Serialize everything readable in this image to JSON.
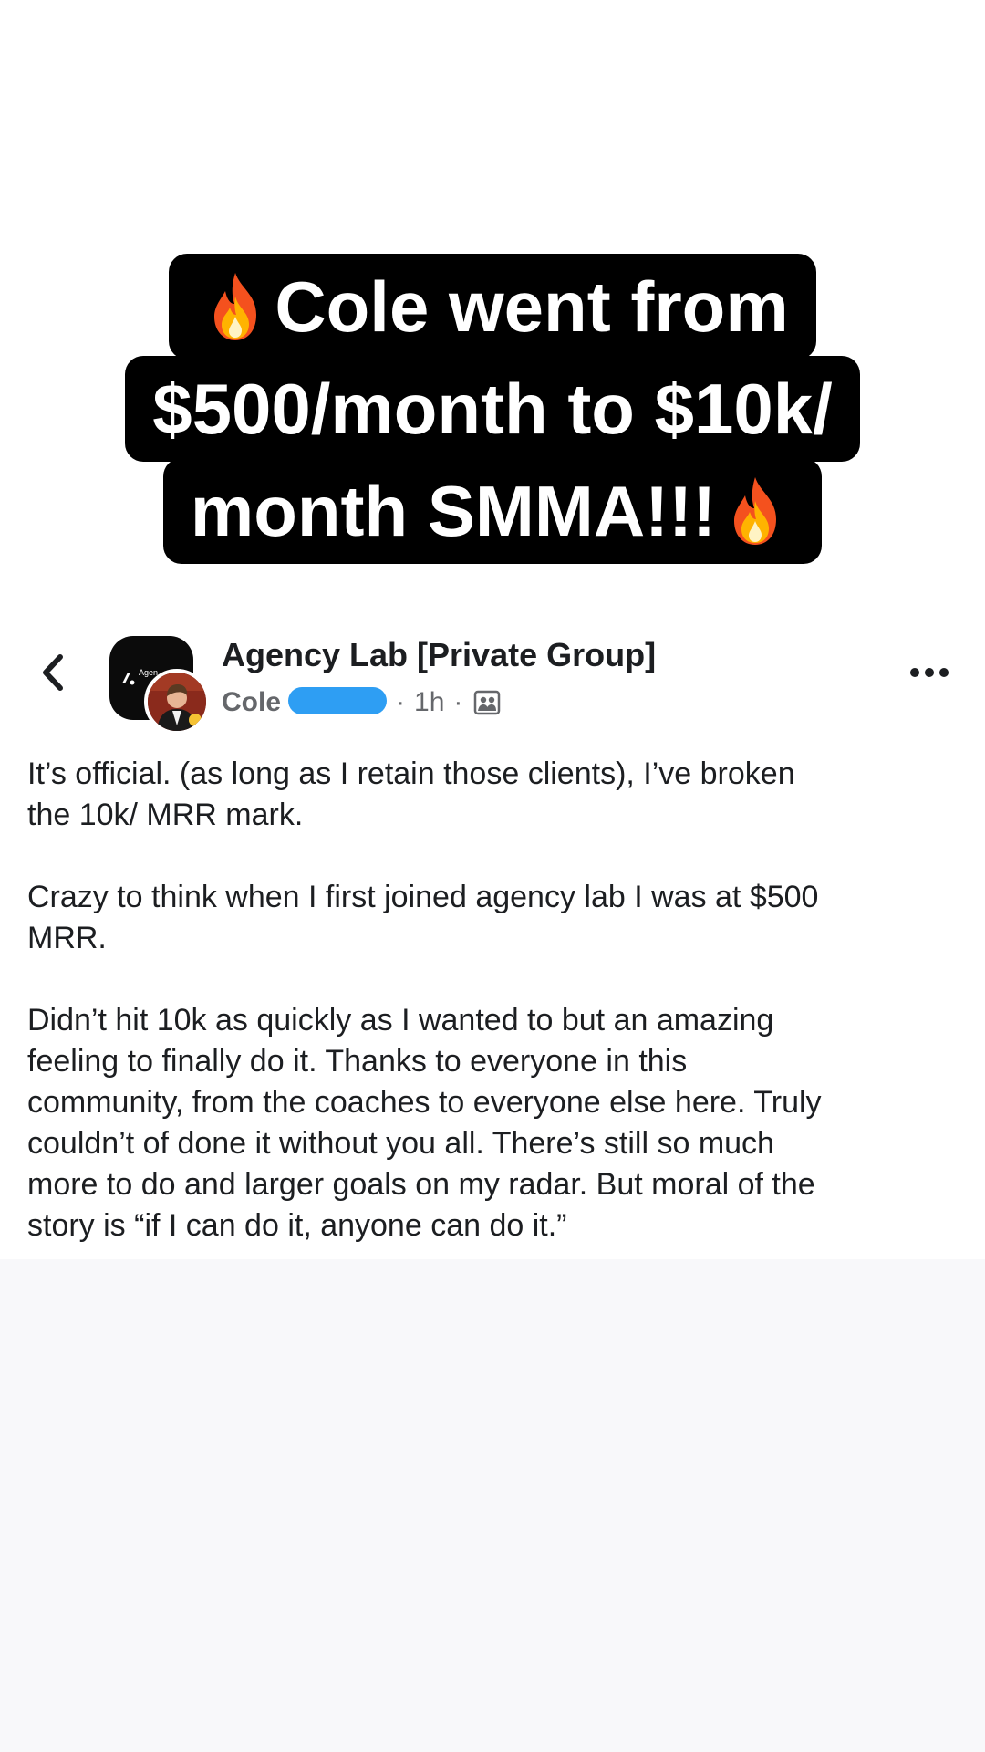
{
  "story_caption": {
    "line1": "Cole went from",
    "line2": "$500/month to $10k/",
    "line3": "month SMMA!!!",
    "emoji": "fire-emoji"
  },
  "post_header": {
    "group_name": "Agency Lab [Private Group]",
    "group_logo_text": "Agen",
    "author_visible": "Cole",
    "author_redacted": true,
    "separator": "·",
    "time": "1h",
    "audience_icon": "group-audience-icon",
    "back_icon": "chevron-left-icon",
    "more_icon": "more-horizontal-icon"
  },
  "post_body": {
    "paragraphs": [
      "It’s official. (as long as I retain those clients), I’ve broken\nthe 10k/ MRR mark.",
      "Crazy to think when I first joined agency lab I was at $500\nMRR.",
      "Didn’t hit 10k as quickly as I wanted to but an amazing\nfeeling to finally do it. Thanks to everyone in this\ncommunity, from the coaches to everyone else here. Truly\ncouldn’t of done it without you all. There’s still so much\nmore to do and larger goals on my radar. But moral of the\nstory is “if I can do it, anyone can do it.”"
    ]
  },
  "colors": {
    "caption_bg": "#000000",
    "caption_text": "#ffffff",
    "redaction": "#2e9ef3",
    "secondary_text": "#65676b",
    "primary_text": "#1c1e21"
  }
}
